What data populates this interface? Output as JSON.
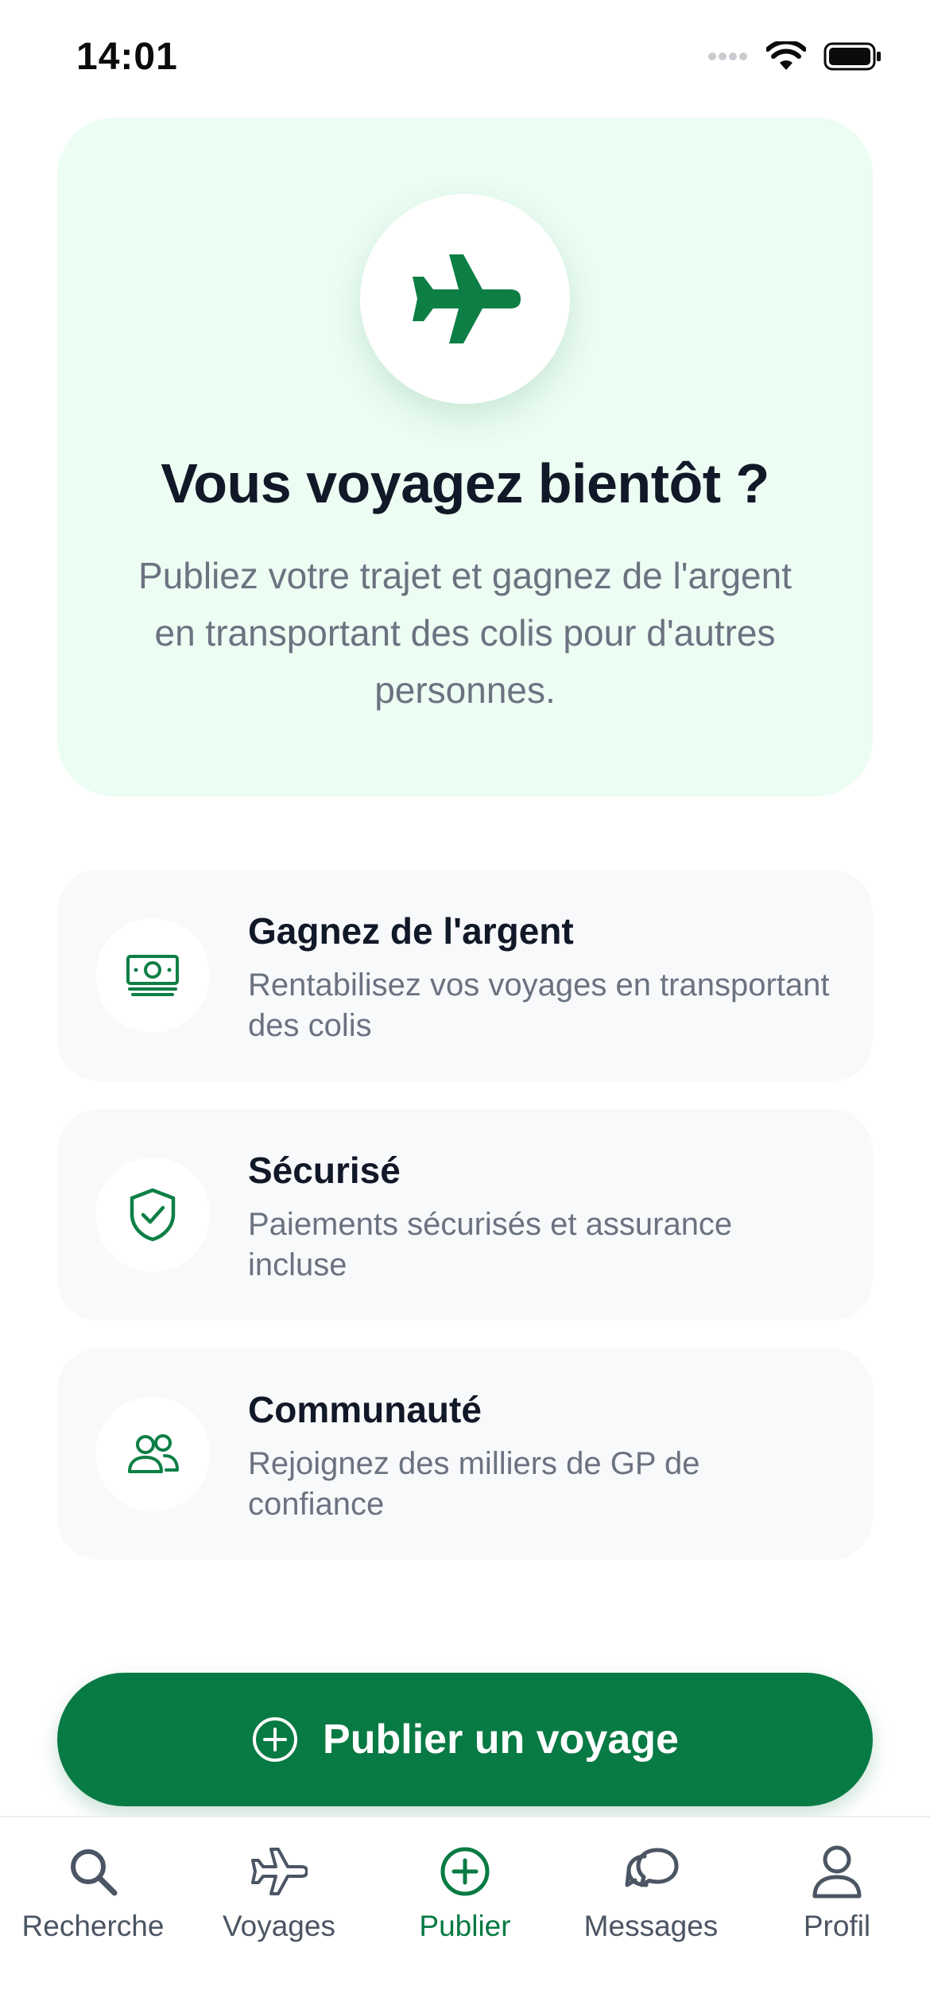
{
  "status_bar": {
    "time": "14:01"
  },
  "hero": {
    "title": "Vous voyagez bientôt ?",
    "subtitle": "Publiez votre trajet et gagnez de l'argent en transportant des colis pour d'autres personnes.",
    "icon": "airplane-icon"
  },
  "features": [
    {
      "title": "Gagnez de l'argent",
      "description": "Rentabilisez vos voyages en transportant des colis",
      "icon": "money-icon"
    },
    {
      "title": "Sécurisé",
      "description": "Paiements sécurisés et assurance incluse",
      "icon": "shield-check-icon"
    },
    {
      "title": "Communauté",
      "description": "Rejoignez des milliers de GP de confiance",
      "icon": "users-icon"
    }
  ],
  "publish_button": {
    "label": "Publier un voyage",
    "icon": "plus-circle-icon"
  },
  "tabs": [
    {
      "label": "Recherche",
      "icon": "search-icon",
      "active": false
    },
    {
      "label": "Voyages",
      "icon": "airplane-icon",
      "active": false
    },
    {
      "label": "Publier",
      "icon": "plus-circle-icon",
      "active": true
    },
    {
      "label": "Messages",
      "icon": "chat-bubbles-icon",
      "active": false
    },
    {
      "label": "Profil",
      "icon": "person-icon",
      "active": false
    }
  ],
  "colors": {
    "accent": "#087a43",
    "hero_background": "#ecfdf3",
    "card_background": "#f8f9fb",
    "text_primary": "#111827",
    "text_secondary": "#6b7280"
  }
}
